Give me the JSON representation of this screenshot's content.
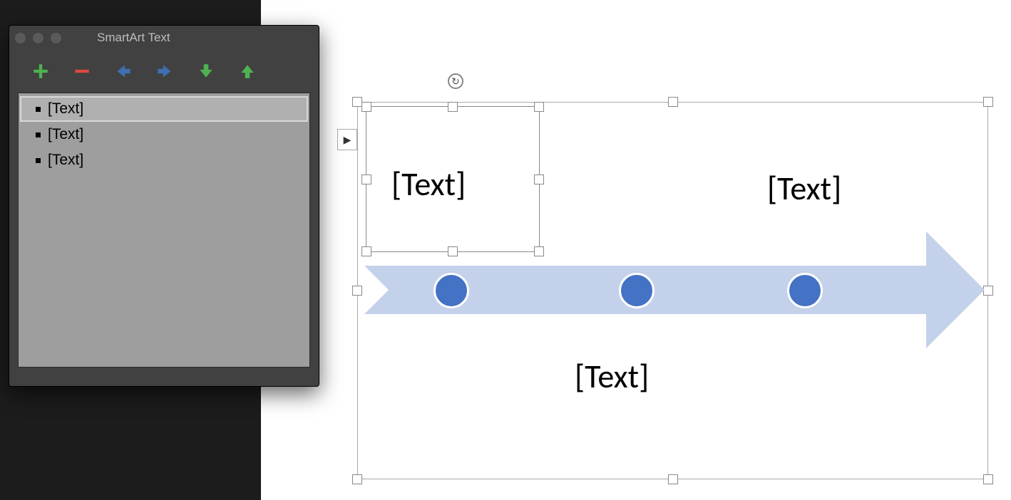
{
  "panel": {
    "title": "SmartArt Text",
    "toolbar": {
      "add": "add-bullet",
      "remove": "remove-bullet",
      "demote": "demote",
      "promote": "promote",
      "move_down": "move-down",
      "move_up": "move-up"
    },
    "items": [
      {
        "label": "[Text]",
        "selected": true
      },
      {
        "label": "[Text]",
        "selected": false
      },
      {
        "label": "[Text]",
        "selected": false
      }
    ]
  },
  "smartart": {
    "labels": {
      "node1": "[Text]",
      "node2": "[Text]",
      "node3": "[Text]"
    },
    "colors": {
      "arrow_fill": "#c4d1ea",
      "dot_fill": "#4472c4"
    }
  }
}
